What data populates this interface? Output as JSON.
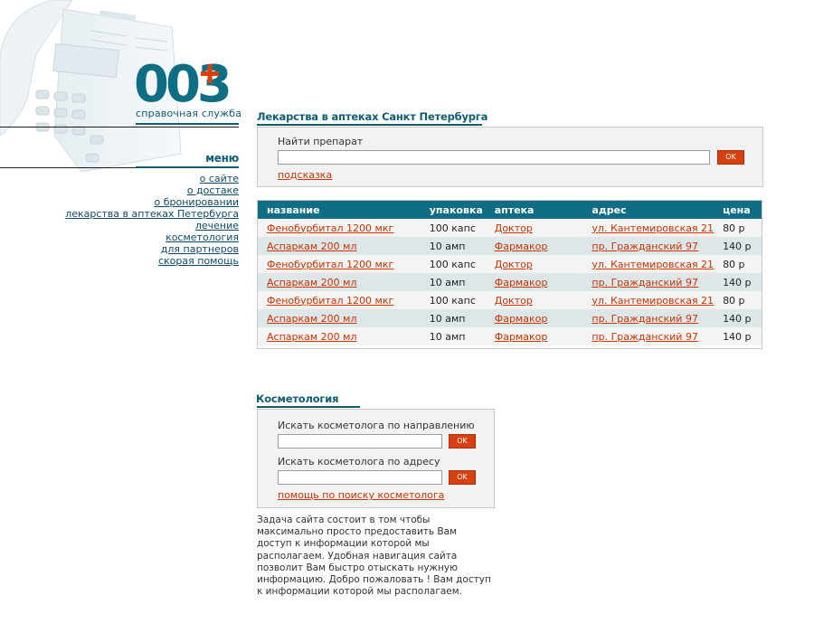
{
  "logo": {
    "main": "003",
    "subtitle": "справочная служба"
  },
  "menu": {
    "title": "меню",
    "items": [
      {
        "label": "о сайте"
      },
      {
        "label": "о достаке"
      },
      {
        "label": "о бронировании"
      },
      {
        "label": "лекарства в аптеках Петербурга"
      },
      {
        "label": "лечение"
      },
      {
        "label": "косметология"
      },
      {
        "label": "для партнеров"
      },
      {
        "label": "скорая помощь"
      }
    ]
  },
  "drugs": {
    "title": "Лекарства в аптеках Санкт Петербурга",
    "search_label": "Найти препарат",
    "search_value": "",
    "ok_label": "OK",
    "hint_label": "подсказка"
  },
  "table": {
    "headers": [
      "название",
      "упаковка",
      "аптека",
      "адрес",
      "цена"
    ],
    "rows": [
      [
        "Фенобурбитал 1200 мкг",
        "100 капс",
        "Доктор",
        "ул. Кантемировская 21",
        "80 р"
      ],
      [
        "Аспаркам 200 мл",
        "10 амп",
        "Фармакор",
        "пр. Гражданский 97",
        "140 р"
      ],
      [
        "Фенобурбитал 1200 мкг",
        "100 капс",
        "Доктор",
        "ул. Кантемировская 21",
        "80 р"
      ],
      [
        "Аспаркам 200 мл",
        "10 амп",
        "Фармакор",
        "пр. Гражданский 97",
        "140 р"
      ],
      [
        "Фенобурбитал 1200 мкг",
        "100 капс",
        "Доктор",
        "ул. Кантемировская 21",
        "80 р"
      ],
      [
        "Аспаркам 200 мл",
        "10 амп",
        "Фармакор",
        "пр. Гражданский 97",
        "140 р"
      ],
      [
        "Аспаркам 200 мл",
        "10 амп",
        "Фармакор",
        "пр. Гражданский 97",
        "140 р"
      ]
    ]
  },
  "cosmetology": {
    "title": "Косметология",
    "direction_label": "Искать косметолога по направлению",
    "direction_value": "",
    "address_label": "Искать косметолога по адресу",
    "address_value": "",
    "ok_label": "OK",
    "help_label": "помощь по поиску косметолога"
  },
  "about_text": "Задача сайта состоит в том чтобы максимально просто предоставить Вам доступ к информации которой мы располагаем. Удобная навигация сайта позволит Вам быстро отыскать нужную информацию. Добро пожаловать !  Вам доступ к информации которой мы располагаем.",
  "colors": {
    "brand": "#0e5e74",
    "accent": "#d9400f",
    "link": "#cc3300",
    "table_header": "#0f6e84"
  }
}
